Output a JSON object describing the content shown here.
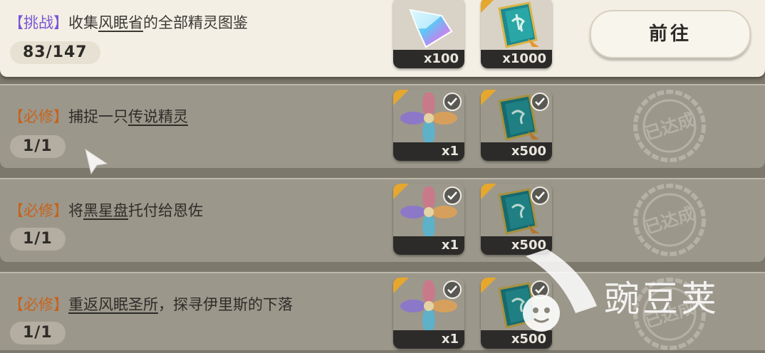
{
  "tasks": [
    {
      "tag": "【挑战】",
      "text_before": "收集",
      "text_link": "风眠省",
      "text_after": "的全部精灵图鉴",
      "progress": "83/147",
      "status": "active",
      "button_label": "前往",
      "rewards": [
        {
          "icon": "crystal-icon",
          "qty": "x100"
        },
        {
          "icon": "skill-book-icon",
          "qty": "x1000"
        }
      ]
    },
    {
      "tag": "【必修】",
      "text_before": "捕捉一只",
      "text_link": "传说精灵",
      "text_after": "",
      "progress": "1/1",
      "status": "completed",
      "stamp_text": "已达成",
      "rewards": [
        {
          "icon": "petal-flower-icon",
          "qty": "x1"
        },
        {
          "icon": "skill-book-icon",
          "qty": "x500"
        }
      ]
    },
    {
      "tag": "【必修】",
      "text_before": "将",
      "text_link": "黑星盘",
      "text_after": "托付给恩佐",
      "progress": "1/1",
      "status": "completed",
      "stamp_text": "已达成",
      "rewards": [
        {
          "icon": "petal-flower-icon",
          "qty": "x1"
        },
        {
          "icon": "skill-book-icon",
          "qty": "x500"
        }
      ]
    },
    {
      "tag": "【必修】",
      "text_before": "",
      "text_link": "重返风眠圣所",
      "text_after": "，探寻伊里斯的下落",
      "progress": "1/1",
      "status": "completed",
      "stamp_text": "已达成",
      "rewards": [
        {
          "icon": "petal-flower-icon",
          "qty": "x1"
        },
        {
          "icon": "skill-book-icon",
          "qty": "x500"
        }
      ]
    }
  ],
  "watermark": {
    "text": "豌豆荚",
    "icon": "wandoujia-logo-icon"
  },
  "colors": {
    "challenge_tag": "#7a55d6",
    "required_tag": "#c8621a",
    "corner": "#e6a72f"
  }
}
